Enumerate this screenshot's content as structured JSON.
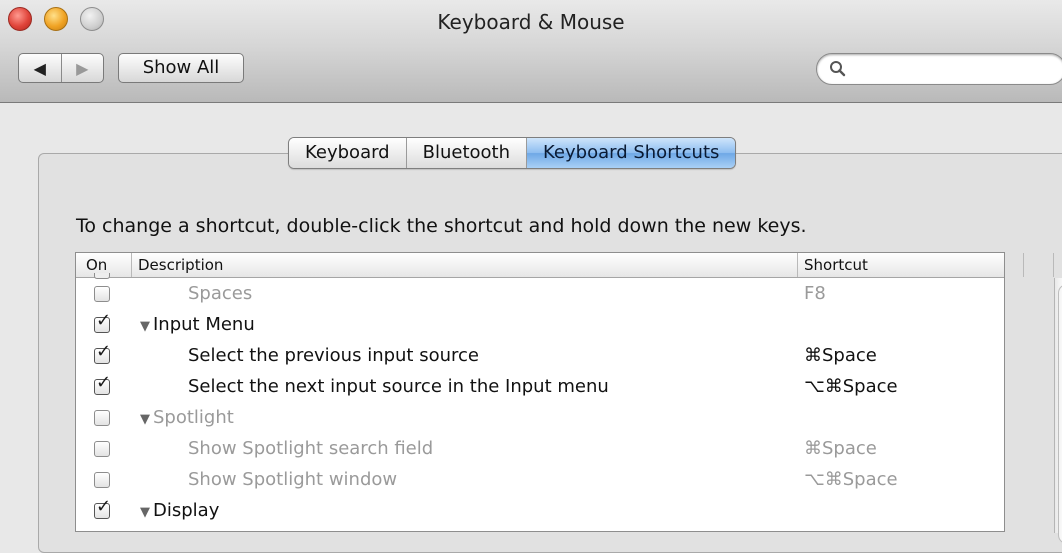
{
  "window": {
    "title": "Keyboard & Mouse"
  },
  "toolbar": {
    "back_glyph": "◀",
    "forward_glyph": "▶",
    "show_all_label": "Show All",
    "search_placeholder": ""
  },
  "tabs": [
    {
      "label": "Keyboard",
      "active": false
    },
    {
      "label": "Bluetooth",
      "active": false
    },
    {
      "label": "Keyboard Shortcuts",
      "active": true
    }
  ],
  "instruction": "To change a shortcut, double-click the shortcut and hold down the new keys.",
  "table": {
    "headers": {
      "on": "On",
      "description": "Description",
      "shortcut": "Shortcut"
    },
    "rows": [
      {
        "checked": false,
        "disabled": true,
        "level": 1,
        "group": false,
        "description": "Spaces",
        "shortcut": "F8"
      },
      {
        "checked": true,
        "disabled": false,
        "level": 0,
        "group": true,
        "description": "Input Menu",
        "shortcut": ""
      },
      {
        "checked": true,
        "disabled": false,
        "level": 1,
        "group": false,
        "description": "Select the previous input source",
        "shortcut": "⌘Space"
      },
      {
        "checked": true,
        "disabled": false,
        "level": 1,
        "group": false,
        "description": "Select the next input source in the Input menu",
        "shortcut": "⌥⌘Space"
      },
      {
        "checked": false,
        "disabled": true,
        "level": 0,
        "group": true,
        "description": "Spotlight",
        "shortcut": ""
      },
      {
        "checked": false,
        "disabled": true,
        "level": 1,
        "group": false,
        "description": "Show Spotlight search field",
        "shortcut": "⌘Space"
      },
      {
        "checked": false,
        "disabled": true,
        "level": 1,
        "group": false,
        "description": "Show Spotlight window",
        "shortcut": "⌥⌘Space"
      },
      {
        "checked": true,
        "disabled": false,
        "level": 0,
        "group": true,
        "description": "Display",
        "shortcut": ""
      }
    ]
  },
  "glyphs": {
    "checkmark": "✓",
    "disclosure": "▼"
  },
  "icons": {
    "search": "magnifier-icon"
  }
}
